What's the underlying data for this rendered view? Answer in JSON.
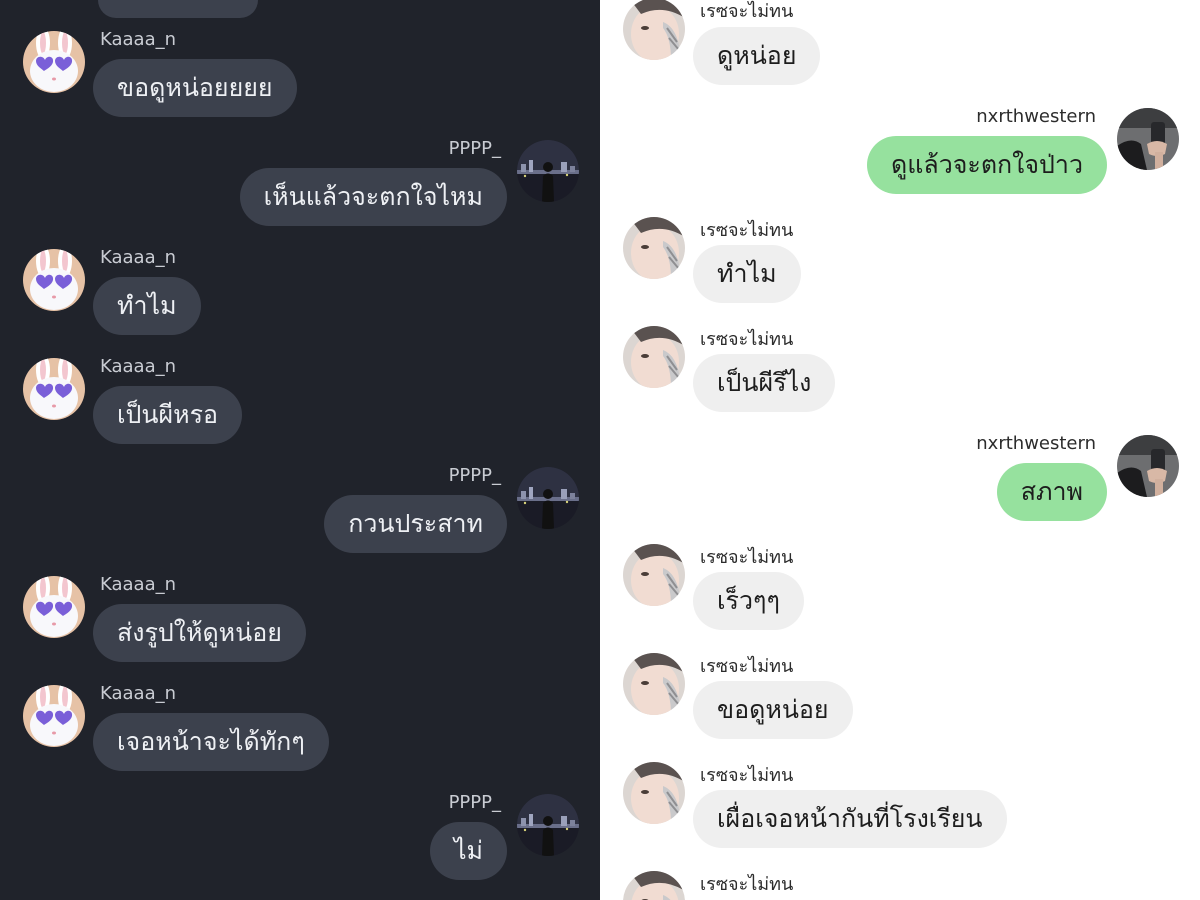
{
  "left_chat": {
    "users": {
      "friend": "Kaaaa_n",
      "me": "PPPP_"
    },
    "messages": [
      {
        "from": "friend",
        "text": "ขอดูหน่อยยยย"
      },
      {
        "from": "me",
        "text": "เห็นแล้วจะตกใจไหม"
      },
      {
        "from": "friend",
        "text": "ทำไม"
      },
      {
        "from": "friend",
        "text": "เป็นผีหรอ"
      },
      {
        "from": "me",
        "text": "กวนประสาท"
      },
      {
        "from": "friend",
        "text": "ส่งรูปให้ดูหน่อย"
      },
      {
        "from": "friend",
        "text": "เจอหน้าจะได้ทักๆ"
      },
      {
        "from": "me",
        "text": "ไม่"
      }
    ]
  },
  "right_chat": {
    "users": {
      "friend": "เรซจะไม่ทน",
      "me": "nxrthwestern"
    },
    "messages": [
      {
        "from": "friend",
        "text": "ดูหน่อย"
      },
      {
        "from": "me",
        "text": "ดูแล้วจะตกใจป่าว"
      },
      {
        "from": "friend",
        "text": "ทำไม"
      },
      {
        "from": "friend",
        "text": "เป็นผีรึไง"
      },
      {
        "from": "me",
        "text": "สภาพ"
      },
      {
        "from": "friend",
        "text": "เร็วๆๆ"
      },
      {
        "from": "friend",
        "text": "ขอดูหน่อย"
      },
      {
        "from": "friend",
        "text": "เผื่อเจอหน้ากันที่โรงเรียน"
      },
      {
        "from": "friend",
        "text": ""
      }
    ]
  },
  "colors": {
    "left_background": "#20232b",
    "left_bubble": "#3c414d",
    "right_background": "#ffffff",
    "right_incoming_bubble": "#efefef",
    "right_outgoing_bubble": "#96e19e"
  },
  "icons": {
    "left_friend_avatar": "bunny-heart-sunglasses-avatar",
    "left_me_avatar": "night-cityscape-avatar",
    "right_friend_avatar": "face-closeup-avatar",
    "right_me_avatar": "mirror-selfie-avatar"
  }
}
